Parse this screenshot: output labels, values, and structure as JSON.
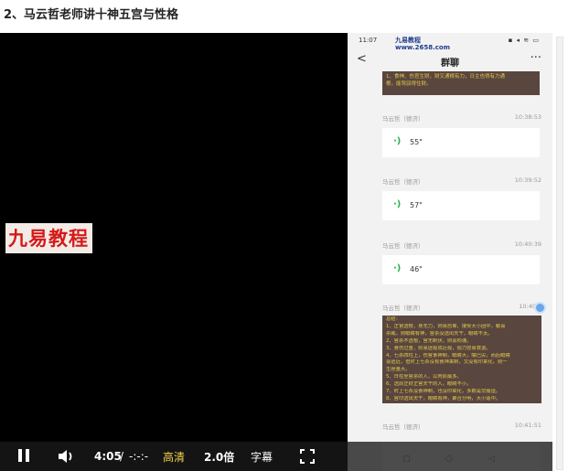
{
  "page": {
    "title": "2、马云哲老师讲十神五宫与性格"
  },
  "player": {
    "watermark_label": "九易教程",
    "controls": {
      "current_time": "4:05",
      "separator": "/",
      "duration": "-:-:-",
      "quality": "高清",
      "speed": "2.0倍",
      "subtitles": "字幕",
      "icons": [
        "pause-icon",
        "volume-icon",
        "fullscreen-icon"
      ]
    }
  },
  "phone": {
    "status_time": "11:07",
    "watermark_line1": "九易教程",
    "watermark_line2": "www.2658.com",
    "header_title": "群聊",
    "note_top": [
      "1、食神、伤官生财，财又通根有力，日主也得有力通",
      "根，能驾驭得住财。"
    ],
    "messages": [
      {
        "sender": "马云哲（德济）",
        "time": "10:38:53",
        "duration": "55\""
      },
      {
        "sender": "马云哲（德济）",
        "time": "10:39:52",
        "duration": "57\""
      },
      {
        "sender": "马云哲（德济）",
        "time": "10:40:39",
        "duration": "46\""
      }
    ],
    "note_message": {
      "sender": "马云哲（德济）",
      "time": "10:40",
      "lines": [
        "总结：",
        "1、正官透根，身无力，则易自卑、接受大小团中，敏喜",
        "杀威，则眼睛有神，官杀没透出天干，眼睛不太。",
        "2、官杀不透根，官无制伏，则会拘谨。",
        "3、食伤过重，则易远视成近视，视力容易衰退。",
        "4、七杀四柱上，伤官食神制，眼睛大，嘴巴尖，而后眼睛",
        "会远近，但时上七杀没有食神来制，又没有印来化，则一",
        "生胆量大。",
        "5、日柱坐官杀的人，以丙辰最多。",
        "6、透辰正财正官天干的人，眼睛不小。",
        "7、时上七杀没食神制，也没印来化，多数是早服运。",
        "8、官印透出天干，眼睛有神，聚合分明，大小适中。"
      ]
    },
    "last_message": {
      "sender": "马云哲（德济）",
      "time": "10:41:51"
    }
  }
}
